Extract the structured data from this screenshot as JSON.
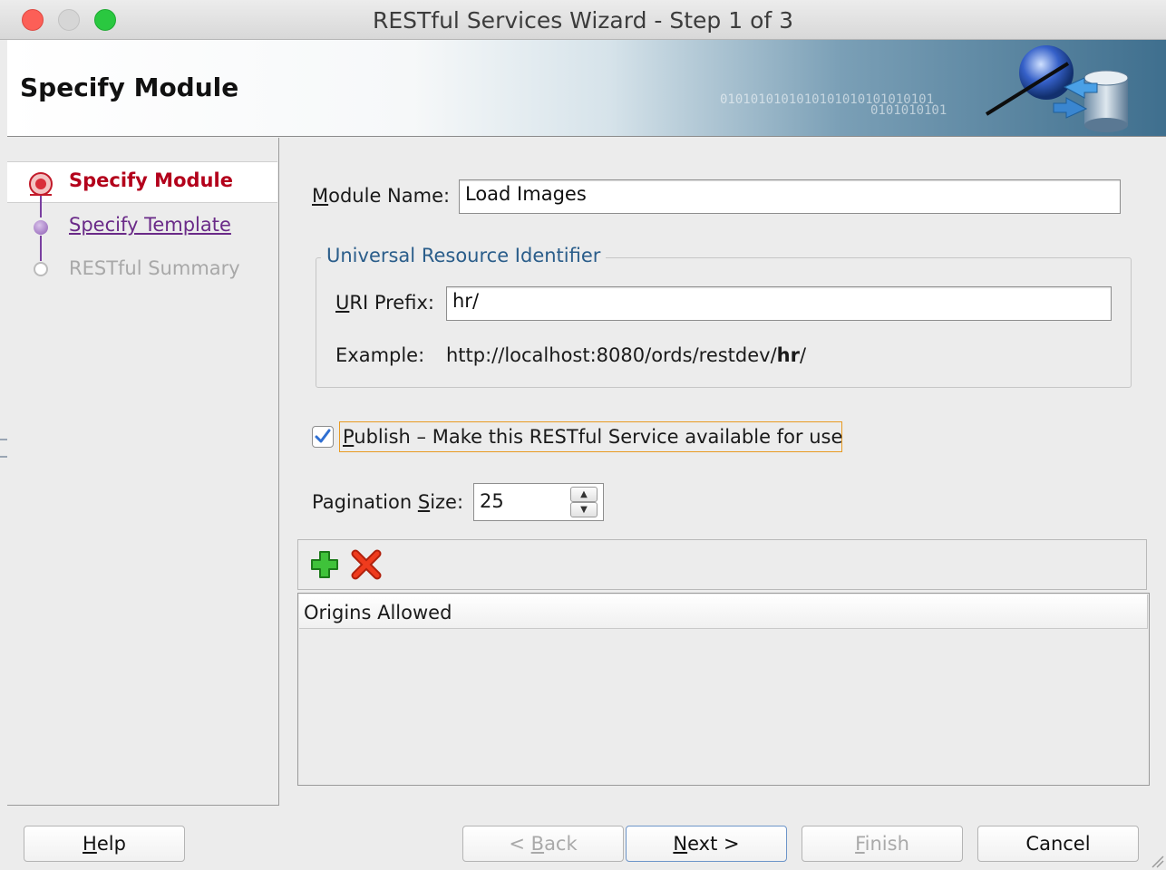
{
  "window": {
    "title": "RESTful Services Wizard - Step 1 of 3"
  },
  "header": {
    "title": "Specify Module",
    "binary_text_1": "0101010101010101010101010101",
    "binary_text_2": "0101010101"
  },
  "steps": [
    {
      "label": "Specify Module",
      "state": "current"
    },
    {
      "label": "Specify Template",
      "state": "next"
    },
    {
      "label": "RESTful Summary",
      "state": "pending"
    }
  ],
  "form": {
    "module_name_label_ul": "M",
    "module_name_label_rest": "odule Name:",
    "module_name_value": "Load Images",
    "uri_group_title": "Universal Resource Identifier",
    "uri_prefix_label_ul": "U",
    "uri_prefix_label_rest": "RI Prefix:",
    "uri_prefix_value": "hr/",
    "example_label": "Example:",
    "example_base": "http://localhost:8080/ords/restdev/",
    "example_prefix": "hr",
    "example_suffix": "/",
    "publish_checked": true,
    "publish_label_ul": "P",
    "publish_label_rest": "ublish – Make this RESTful Service available for use",
    "pagination_label_pre": "Pagination ",
    "pagination_label_ul": "S",
    "pagination_label_post": "ize:",
    "pagination_value": "25"
  },
  "origins_table": {
    "add_icon": "green-plus-icon",
    "remove_icon": "red-x-icon",
    "column_header": "Origins Allowed",
    "rows": []
  },
  "buttons": {
    "help_ul": "H",
    "help_rest": "elp",
    "back_pre": "< ",
    "back_ul": "B",
    "back_rest": "ack",
    "next_ul": "N",
    "next_rest": "ext >",
    "finish_ul": "F",
    "finish_rest": "inish",
    "cancel": "Cancel"
  },
  "colors": {
    "current_step": "#b3001b",
    "next_step_link": "#6a2a88",
    "group_title": "#2a5d8a",
    "focus_ring": "#e89a22"
  }
}
